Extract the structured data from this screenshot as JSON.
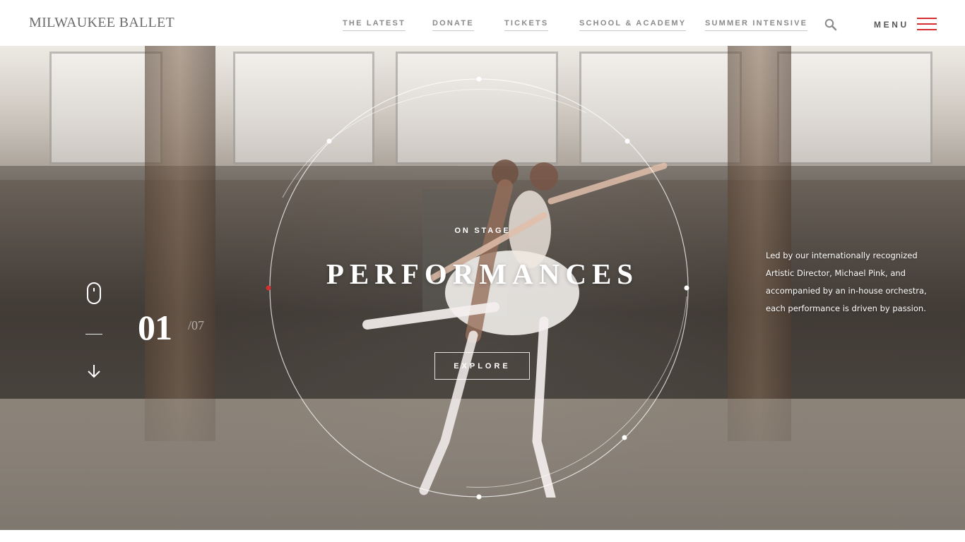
{
  "header": {
    "logo": "MILWAUKEE BALLET",
    "nav": [
      {
        "label": "THE LATEST"
      },
      {
        "label": "DONATE"
      },
      {
        "label": "TICKETS"
      },
      {
        "label": "SCHOOL & ACADEMY"
      },
      {
        "label": "SUMMER INTENSIVE"
      }
    ],
    "search_icon": "search-icon",
    "menu_label": "MENU",
    "menu_icon": "hamburger-icon"
  },
  "hero": {
    "eyebrow": "ON STAGE",
    "title": "PERFORMANCES",
    "cta_label": "EXPLORE",
    "slide_current": "01",
    "slide_total": "/07",
    "description": "Led by our internationally recognized Artistic Director, Michael Pink, and accompanied by an in-house orchestra, each performance is driven by passion."
  },
  "colors": {
    "accent": "#d32f2f",
    "nav_text": "#8a8a8a",
    "logo_text": "#6b6b6b",
    "hero_text": "#ffffff"
  }
}
